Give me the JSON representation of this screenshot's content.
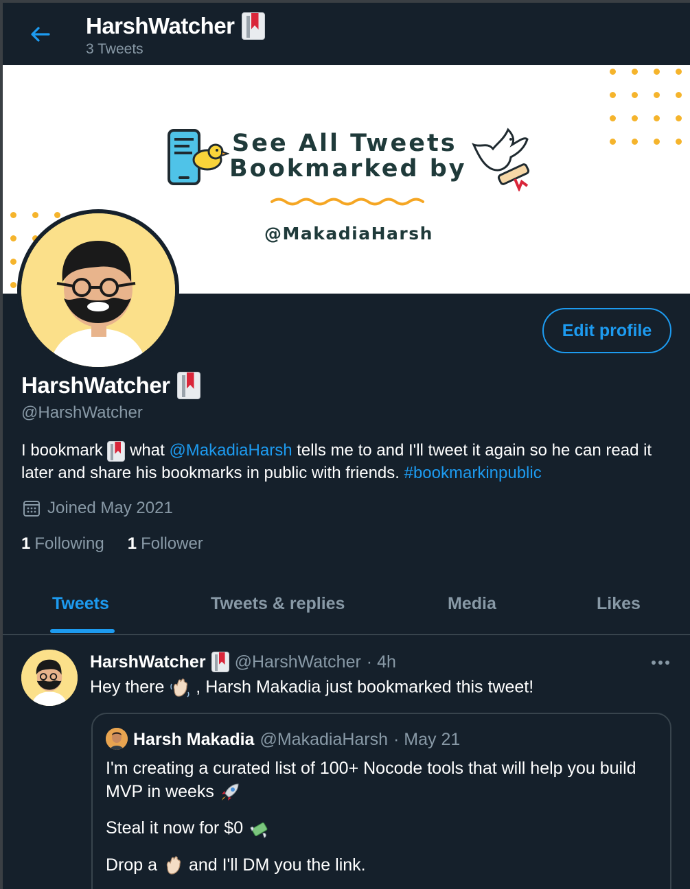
{
  "header": {
    "title": "HarshWatcher",
    "tweet_count": "3 Tweets"
  },
  "banner": {
    "line1": "See All Tweets",
    "line2": "Bookmarked by",
    "handle": "@MakadiaHarsh"
  },
  "profile": {
    "name": "HarshWatcher",
    "handle": "@HarshWatcher",
    "edit_label": "Edit profile",
    "bio": {
      "part1": "I bookmark",
      "part2": "what",
      "mention": "@MakadiaHarsh",
      "part3": "tells me to and I'll tweet it again so he can read it later and share his bookmarks in public with friends.",
      "hashtag": "#bookmarkinpublic"
    },
    "joined": "Joined May 2021",
    "following_count": "1",
    "following_label": "Following",
    "followers_count": "1",
    "followers_label": "Follower"
  },
  "tabs": [
    {
      "label": "Tweets",
      "active": true
    },
    {
      "label": "Tweets & replies",
      "active": false
    },
    {
      "label": "Media",
      "active": false
    },
    {
      "label": "Likes",
      "active": false
    }
  ],
  "tweet": {
    "name": "HarshWatcher",
    "handle": "@HarshWatcher",
    "time": "· 4h",
    "text_before": "Hey there",
    "text_after": ", Harsh Makadia just bookmarked this tweet!",
    "quote": {
      "name": "Harsh Makadia",
      "handle": "@MakadiaHarsh",
      "time": "· May 21",
      "para1": "I'm creating a curated list of 100+ Nocode tools that will help you build MVP in weeks",
      "para2": "Steal it now for $0",
      "para3_before": "Drop a",
      "para3_after": "and I'll DM you the link."
    }
  },
  "colors": {
    "background": "#15202b",
    "accent": "#1d9bf0",
    "muted": "#8899a6",
    "divider": "#38444d"
  }
}
